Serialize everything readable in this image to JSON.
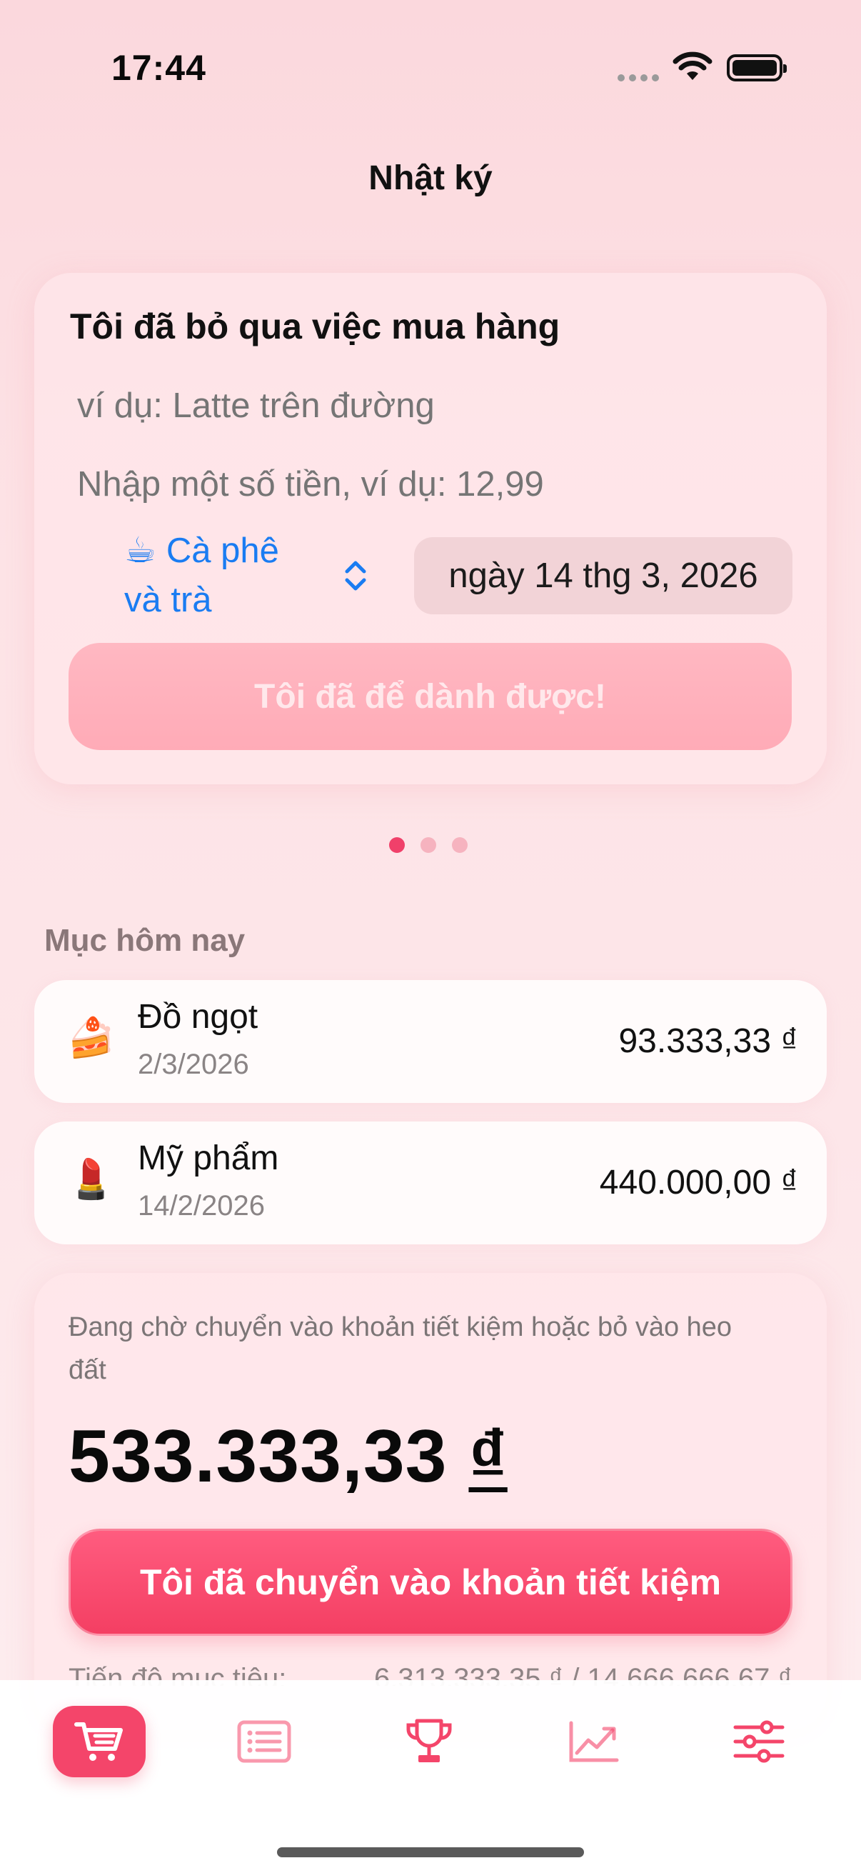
{
  "status_bar": {
    "time": "17:44"
  },
  "header": {
    "title": "Nhật ký"
  },
  "entry_form": {
    "title": "Tôi đã bỏ qua việc mua hàng",
    "item_placeholder": "ví dụ: Latte trên đường",
    "amount_placeholder": "Nhập một số tiền, ví dụ: 12,99",
    "category_emoji": "☕",
    "category_line1": "Cà phê",
    "category_line2": "và trà",
    "date": "ngày 14 thg 3, 2026",
    "submit_label": "Tôi đã để dành được!"
  },
  "pager": {
    "count": 3,
    "active_index": 0
  },
  "today_section": {
    "label": "Mục hôm nay",
    "items": [
      {
        "emoji": "🍰",
        "name": "Đồ ngọt",
        "date": "2/3/2026",
        "amount": "93.333,33 ₫"
      },
      {
        "emoji": "💄",
        "name": "Mỹ phẩm",
        "date": "14/2/2026",
        "amount": "440.000,00 ₫"
      }
    ]
  },
  "pending": {
    "description": "Đang chờ chuyển vào khoản tiết kiệm hoặc bỏ vào heo đất",
    "amount_number": "533.333,33",
    "amount_currency": "₫",
    "transfer_label": "Tôi đã chuyển vào khoản tiết kiệm",
    "progress_label": "Tiến độ mục tiêu:",
    "progress_value": "6.313.333,35 ₫ / 14.666.666,67 ₫"
  },
  "tab_bar": {
    "tabs": [
      {
        "icon": "cart-icon",
        "active": true
      },
      {
        "icon": "list-icon",
        "active": false
      },
      {
        "icon": "trophy-icon",
        "active": false
      },
      {
        "icon": "chart-icon",
        "active": false
      },
      {
        "icon": "sliders-icon",
        "active": false
      }
    ]
  },
  "colors": {
    "accent": "#f4456a",
    "link_blue": "#1a7cf2",
    "disabled_button": "#ffb0bc"
  }
}
